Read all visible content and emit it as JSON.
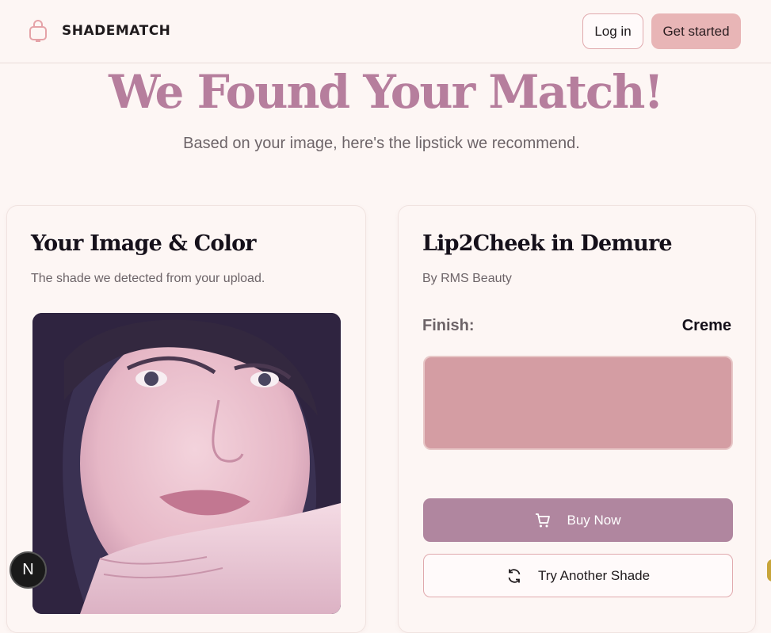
{
  "header": {
    "brand": "SHADEMATCH",
    "brand_icon": "shopping-bag-icon",
    "login_label": "Log in",
    "start_label": "Get started"
  },
  "hero": {
    "title": "We Found Your Match!",
    "subtitle": "Based on your image, here's the lipstick we recommend."
  },
  "image_card": {
    "title": "Your Image & Color",
    "subtitle": "The shade we detected from your upload."
  },
  "product_card": {
    "name": "Lip2Cheek in Demure",
    "brand": "By RMS Beauty",
    "finish_label": "Finish:",
    "finish_value": "Creme",
    "swatch_color": "#d49da3",
    "buy_label": "Buy Now",
    "buy_icon": "shopping-cart-icon",
    "try_label": "Try Another Shade",
    "try_icon": "refresh-icon"
  },
  "dev_badge": {
    "label": "N"
  },
  "colors": {
    "accent": "#b67e9d",
    "primary_button": "#b0869f",
    "secondary_button": "#e8b5b6",
    "background": "#fdf6f4"
  }
}
